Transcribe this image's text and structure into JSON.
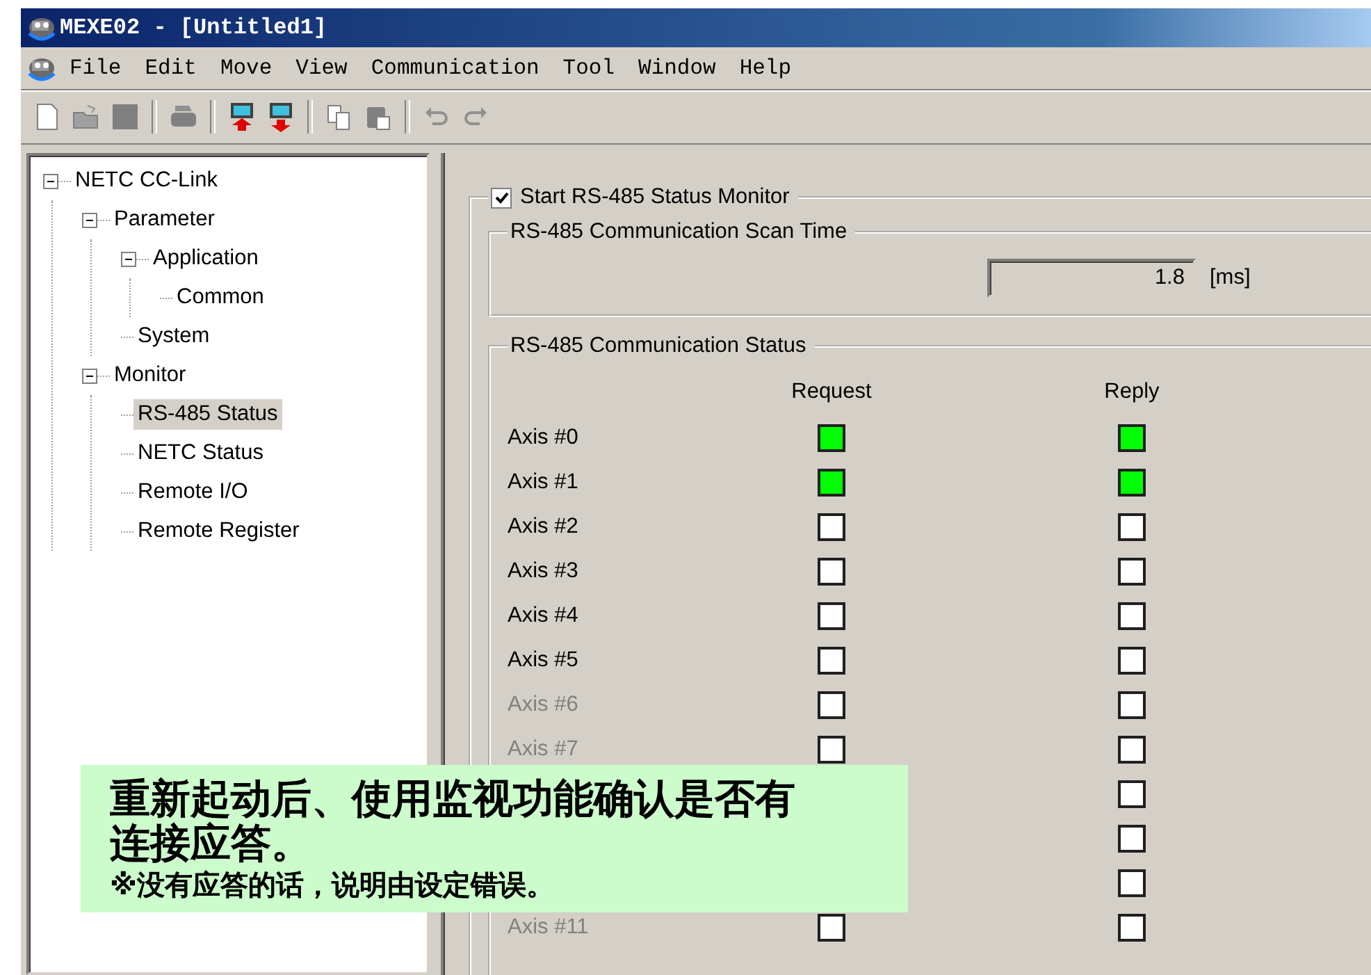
{
  "window": {
    "title": "MEXE02 - [Untitled1]"
  },
  "menu": [
    {
      "label": "File"
    },
    {
      "label": "Edit"
    },
    {
      "label": "Move"
    },
    {
      "label": "View"
    },
    {
      "label": "Communication"
    },
    {
      "label": "Tool"
    },
    {
      "label": "Window"
    },
    {
      "label": "Help"
    }
  ],
  "tree": [
    {
      "label": "NETC CC-Link",
      "expanded": true,
      "selected": false,
      "children": [
        {
          "label": "Parameter",
          "expanded": true,
          "selected": false,
          "children": [
            {
              "label": "Application",
              "expanded": true,
              "selected": false,
              "children": [
                {
                  "label": "Common",
                  "selected": false
                }
              ]
            },
            {
              "label": "System",
              "selected": false
            }
          ]
        },
        {
          "label": "Monitor",
          "expanded": true,
          "selected": false,
          "children": [
            {
              "label": "RS-485 Status",
              "selected": true
            },
            {
              "label": "NETC Status",
              "selected": false
            },
            {
              "label": "Remote I/O",
              "selected": false
            },
            {
              "label": "Remote Register",
              "selected": false
            }
          ]
        }
      ]
    }
  ],
  "monitor": {
    "label": "Start RS-485 Status Monitor",
    "checked": true
  },
  "scan_time": {
    "title": "RS-485 Communication Scan Time",
    "value": "1.8",
    "unit": "[ms]"
  },
  "status": {
    "title": "RS-485 Communication Status",
    "columns": [
      "Request",
      "Reply"
    ],
    "rows": [
      {
        "label": "Axis #0",
        "disabled": false,
        "request": true,
        "reply": true
      },
      {
        "label": "Axis #1",
        "disabled": false,
        "request": true,
        "reply": true
      },
      {
        "label": "Axis #2",
        "disabled": false,
        "request": false,
        "reply": false
      },
      {
        "label": "Axis #3",
        "disabled": false,
        "request": false,
        "reply": false
      },
      {
        "label": "Axis #4",
        "disabled": false,
        "request": false,
        "reply": false
      },
      {
        "label": "Axis #5",
        "disabled": false,
        "request": false,
        "reply": false
      },
      {
        "label": "Axis #6",
        "disabled": true,
        "request": false,
        "reply": false
      },
      {
        "label": "Axis #7",
        "disabled": true,
        "request": false,
        "reply": false
      },
      {
        "reply": false
      },
      {
        "reply": false
      },
      {
        "reply": false
      },
      {
        "label": "Axis #11",
        "disabled": true,
        "request": false,
        "reply": false
      }
    ]
  },
  "callout": {
    "text": "重新起动后、使用监视功能确认是否有连接应答。",
    "note": "※没有应答的话，说明由设定错误。"
  }
}
